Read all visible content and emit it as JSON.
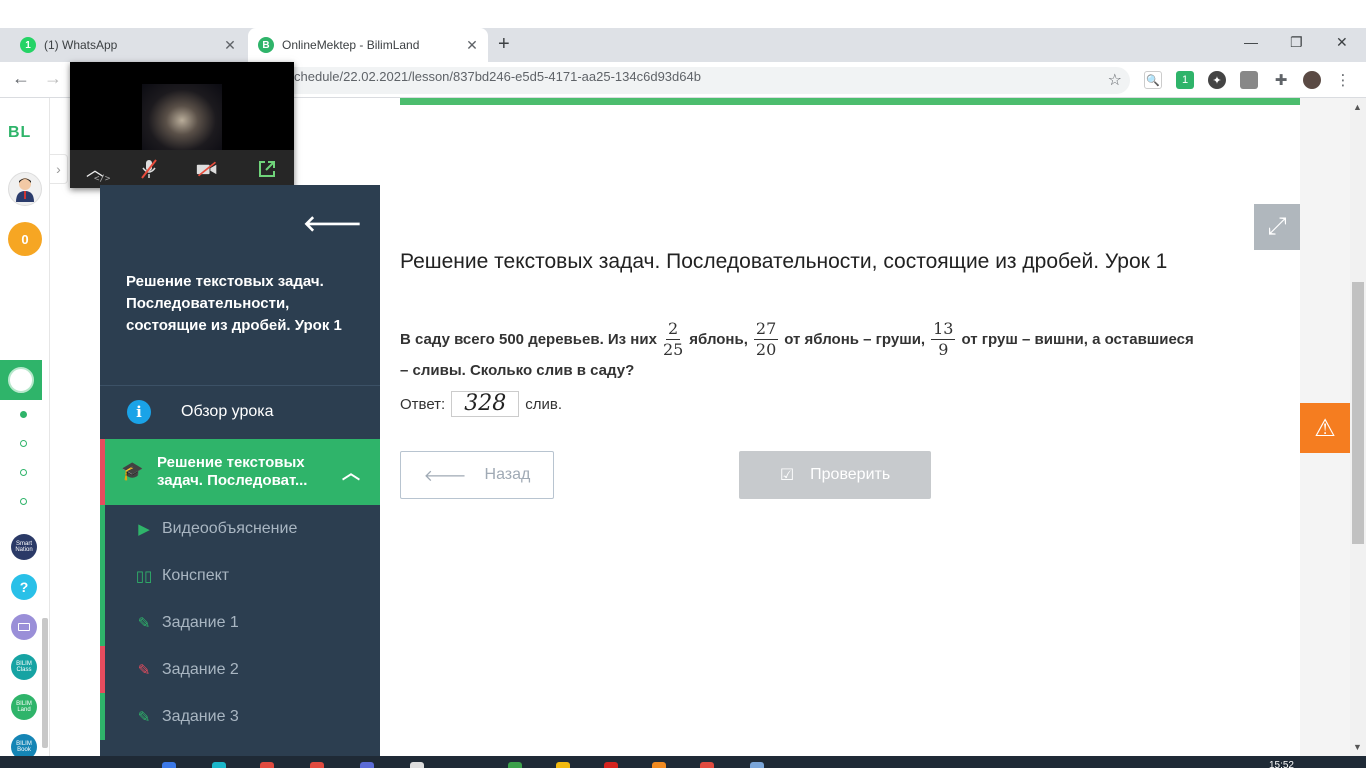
{
  "browser": {
    "tabs": [
      {
        "label": "(1) WhatsApp",
        "favicon": "whatsapp-icon",
        "badge": "1",
        "active": false
      },
      {
        "label": "OnlineMektep - BilimLand",
        "favicon": "bilimland-icon",
        "badge": "B",
        "active": true
      }
    ],
    "new_tab_glyph": "+",
    "window_controls": {
      "minimize": "—",
      "maximize": "❐",
      "close": "✕"
    },
    "url": "chedule/22.02.2021/lesson/837bd246-e5d5-4171-aa25-134c6d93d64b",
    "extension_badge": "1"
  },
  "rail": {
    "logo": "BL",
    "coins": "0",
    "apps": [
      "Smart Nation",
      "?",
      "",
      "BILIM Class",
      "BILIM Land",
      "BILIM Book"
    ]
  },
  "video": {
    "tag": "</>"
  },
  "sidebar": {
    "title": "Решение текстовых задач. Последовательности, состоящие из дробей. Урок 1",
    "overview_label": "Обзор урока",
    "section_title": "Решение текстовых задач. Последоват...",
    "items": [
      {
        "label": "Видеообъяснение",
        "icon": "play-icon",
        "status": "green"
      },
      {
        "label": "Конспект",
        "icon": "book-icon",
        "status": "green"
      },
      {
        "label": "Задание 1",
        "icon": "edit-icon",
        "status": "green"
      },
      {
        "label": "Задание 2",
        "icon": "edit-icon",
        "status": "red"
      },
      {
        "label": "Задание 3",
        "icon": "edit-icon",
        "status": "green"
      }
    ]
  },
  "main": {
    "lesson_title": "Решение текстовых задач. Последовательности, состоящие из дробей. Урок 1",
    "task": {
      "part1": "В саду всего 500 деревьев. Из них",
      "frac1_num": "2",
      "frac1_den": "25",
      "part2": "яблонь,",
      "frac2_num": "27",
      "frac2_den": "20",
      "part3": "от яблонь – груши,",
      "frac3_num": "13",
      "frac3_den": "9",
      "part4": "от груш – вишни, а оставшиеся",
      "line2": "– сливы. Сколько слив в саду?"
    },
    "answer_label": "Ответ:",
    "answer_value": "328",
    "answer_unit": "слив.",
    "back_button": "Назад",
    "check_button": "Проверить"
  },
  "taskbar": {
    "clock": "15:52"
  },
  "colors": {
    "brand_green": "#2fb46a",
    "sidebar_bg": "#2c3e50",
    "error_red": "#e74c5e",
    "warning_orange": "#f57d20"
  }
}
